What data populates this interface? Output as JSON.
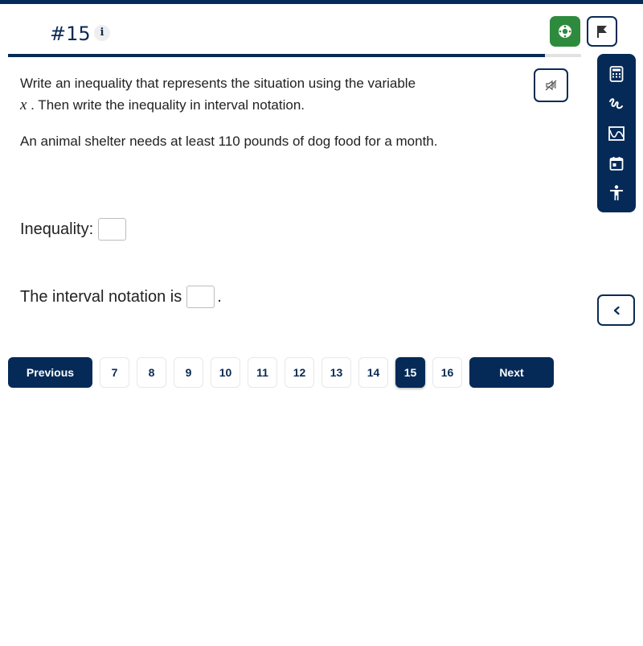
{
  "header": {
    "question_number": "#15",
    "info_icon": "info-icon",
    "green_button_icon": "lifebuoy-icon",
    "flag_icon": "flag-icon",
    "progress": {
      "current": 15,
      "total": 16
    }
  },
  "audio": {
    "icon": "speaker-muted-icon"
  },
  "toolbar": {
    "tools": [
      {
        "name": "calculator",
        "icon": "calculator-icon"
      },
      {
        "name": "scratchpad",
        "icon": "scribble-icon"
      },
      {
        "name": "graph",
        "icon": "graph-icon"
      },
      {
        "name": "calendar",
        "icon": "calendar-icon"
      },
      {
        "name": "accessibility",
        "icon": "accessibility-icon"
      }
    ]
  },
  "question": {
    "instruction_part1": "Write an inequality that represents the situation using the variable",
    "variable": "x",
    "instruction_part2": ". Then write the inequality in interval notation.",
    "scenario": "An animal shelter needs at least 110 pounds of dog food for a month.",
    "inequality_label": "Inequality:",
    "inequality_value": "",
    "interval_label": "The interval notation is",
    "interval_value": "",
    "interval_suffix": "."
  },
  "pager": {
    "previous_label": "Previous",
    "next_label": "Next",
    "pages": [
      "7",
      "8",
      "9",
      "10",
      "11",
      "12",
      "13",
      "14",
      "15",
      "16"
    ],
    "active_page": "15"
  },
  "colors": {
    "primary": "#062a57",
    "green": "#2e8b3e",
    "progress_track": "#e2e2e2"
  }
}
